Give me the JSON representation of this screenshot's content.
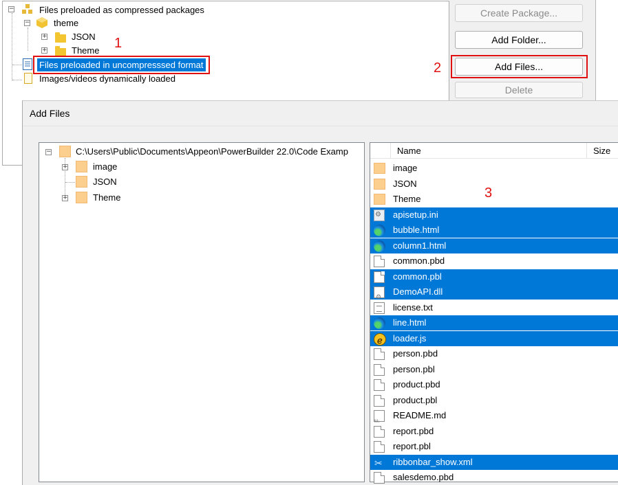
{
  "project_tree": {
    "root1_label": "Files preloaded as compressed packages",
    "theme_label": "theme",
    "json_label": "JSON",
    "theme_sub_label": "Theme",
    "uncompressed_label": "Files preloaded in uncompresssed format",
    "dynamic_label": "Images/videos dynamically loaded"
  },
  "buttons": {
    "create_package": "Create Package...",
    "add_folder": "Add Folder...",
    "add_files": "Add Files...",
    "delete": "Delete"
  },
  "annotations": {
    "one": "1",
    "two": "2",
    "three": "3"
  },
  "dialog": {
    "title": "Add Files",
    "folder_path": "C:\\Users\\Public\\Documents\\Appeon\\PowerBuilder 22.0\\Code Examp",
    "folder_children": [
      "image",
      "JSON",
      "Theme"
    ],
    "columns": {
      "name": "Name",
      "size": "Size"
    },
    "files": [
      {
        "name": "image",
        "icon": "folder-icon",
        "selected": false
      },
      {
        "name": "JSON",
        "icon": "folder-icon",
        "selected": false
      },
      {
        "name": "Theme",
        "icon": "folder-icon",
        "selected": false
      },
      {
        "name": "apisetup.ini",
        "icon": "ini-file-icon",
        "selected": true
      },
      {
        "name": "bubble.html",
        "icon": "edge-html-icon",
        "selected": true
      },
      {
        "name": "column1.html",
        "icon": "edge-html-icon",
        "selected": true
      },
      {
        "name": "common.pbd",
        "icon": "file-icon",
        "selected": false
      },
      {
        "name": "common.pbl",
        "icon": "file-icon",
        "selected": true
      },
      {
        "name": "DemoAPI.dll",
        "icon": "dll-file-icon",
        "selected": true
      },
      {
        "name": "license.txt",
        "icon": "text-file-icon",
        "selected": false
      },
      {
        "name": "line.html",
        "icon": "edge-html-icon",
        "selected": true
      },
      {
        "name": "loader.js",
        "icon": "js-file-icon",
        "selected": true
      },
      {
        "name": "person.pbd",
        "icon": "file-icon",
        "selected": false
      },
      {
        "name": "person.pbl",
        "icon": "file-icon",
        "selected": false
      },
      {
        "name": "product.pbd",
        "icon": "file-icon",
        "selected": false
      },
      {
        "name": "product.pbl",
        "icon": "file-icon",
        "selected": false
      },
      {
        "name": "README.md",
        "icon": "markdown-file-icon",
        "selected": false
      },
      {
        "name": "report.pbd",
        "icon": "file-icon",
        "selected": false
      },
      {
        "name": "report.pbl",
        "icon": "file-icon",
        "selected": false
      },
      {
        "name": "ribbonbar_show.xml",
        "icon": "xml-file-icon",
        "selected": true
      },
      {
        "name": "salesdemo.pbd",
        "icon": "file-icon",
        "selected": false
      }
    ]
  },
  "colors": {
    "selection": "#0078d7",
    "annotation_red": "#e01010"
  }
}
